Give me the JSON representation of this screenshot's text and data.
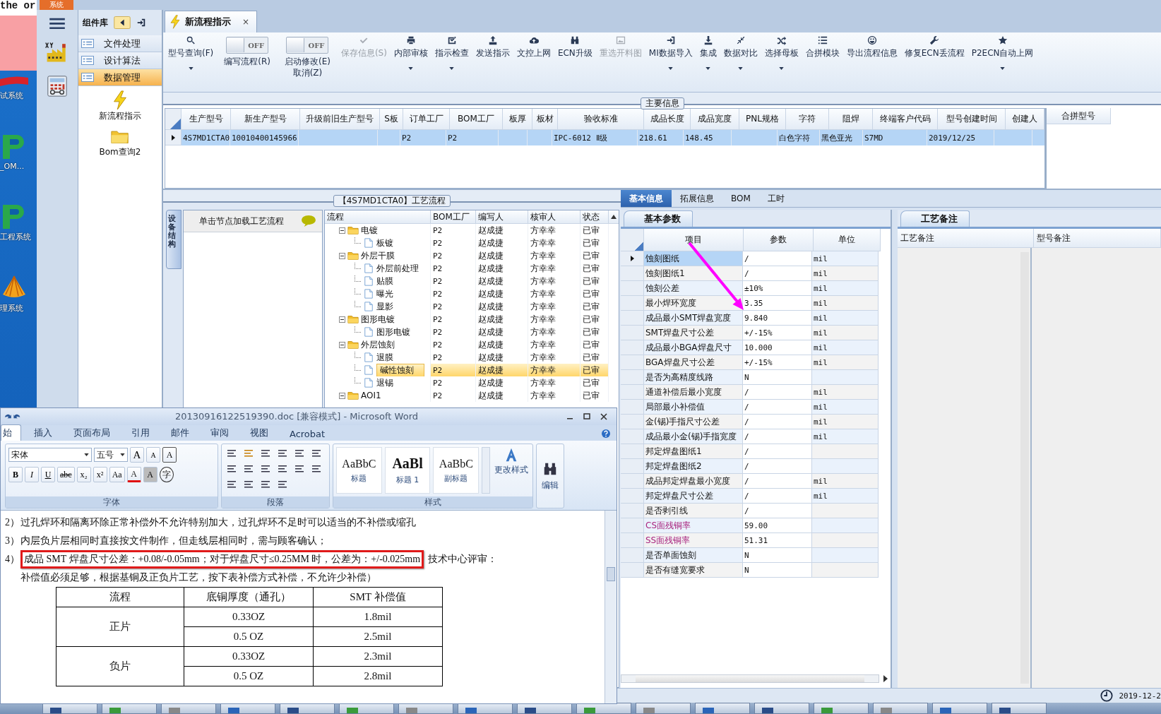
{
  "desktop": {
    "corner_text": "the or",
    "icons": [
      {
        "label": "试系统"
      },
      {
        "label": "_OM..."
      },
      {
        "label": "工程系统"
      },
      {
        "label": "理系统"
      }
    ]
  },
  "app": {
    "menu_tab": "系统",
    "component_library": {
      "title": "组件库",
      "items": [
        {
          "label": "文件处理",
          "selected": false
        },
        {
          "label": "设计算法",
          "selected": false
        },
        {
          "label": "数据管理",
          "selected": true
        }
      ],
      "tools": [
        {
          "label": "新流程指示",
          "kind": "bolt"
        },
        {
          "label": "Bom查询2",
          "kind": "folder"
        }
      ]
    },
    "doc_tab": {
      "label": "新流程指示",
      "close": "×"
    },
    "toolbar": [
      {
        "kind": "button",
        "label": "型号查询(F)",
        "dropdown": true,
        "disabled": false
      },
      {
        "kind": "toggle",
        "switch_text": "OFF",
        "on": false,
        "label": "编写流程(R)"
      },
      {
        "kind": "toggle",
        "switch_text": "OFF",
        "on": false,
        "label": "启动修改(E)",
        "label_line2": "取消(Z)"
      },
      {
        "kind": "button",
        "label": "保存信息(S)",
        "dropdown": false,
        "disabled": true
      },
      {
        "kind": "button",
        "label": "内部审核",
        "dropdown": true,
        "disabled": false
      },
      {
        "kind": "button",
        "label": "指示检查",
        "dropdown": true,
        "disabled": false
      },
      {
        "kind": "button",
        "label": "发送指示",
        "dropdown": false,
        "disabled": false
      },
      {
        "kind": "button",
        "label": "文控上网",
        "dropdown": false,
        "disabled": false
      },
      {
        "kind": "button",
        "label": "ECN升级",
        "dropdown": false,
        "disabled": false
      },
      {
        "kind": "button",
        "label": "重选开料图",
        "dropdown": false,
        "disabled": true
      },
      {
        "kind": "button",
        "label": "MI数据导入",
        "dropdown": true,
        "disabled": false
      },
      {
        "kind": "button",
        "label": "集成",
        "dropdown": true,
        "disabled": false
      },
      {
        "kind": "button",
        "label": "数据对比",
        "dropdown": true,
        "disabled": false
      },
      {
        "kind": "button",
        "label": "选择母板",
        "dropdown": true,
        "disabled": false
      },
      {
        "kind": "button",
        "label": "合拼模块",
        "dropdown": false,
        "disabled": false
      },
      {
        "kind": "button",
        "label": "导出流程信息",
        "dropdown": false,
        "disabled": false
      },
      {
        "kind": "button",
        "label": "修复ECN丢流程",
        "dropdown": false,
        "disabled": false
      },
      {
        "kind": "button",
        "label": "P2ECN自动上网",
        "dropdown": true,
        "disabled": false
      }
    ],
    "main_info": {
      "title": "主要信息",
      "columns": [
        "生产型号",
        "新生产型号",
        "升级前旧生产型号",
        "S板",
        "订单工厂",
        "BOM工厂",
        "板厚",
        "板材",
        "验收标准",
        "成品长度",
        "成品宽度",
        "PNL规格",
        "字符",
        "阻焊",
        "终端客户代码",
        "型号创建时间",
        "创建人"
      ],
      "rows": [
        {
          "selected": true,
          "cells": [
            "4S7MD1CTA0",
            "10010400145966",
            null,
            null,
            "P2",
            "P2",
            null,
            null,
            "IPC-6012 Ⅱ级",
            "218.61",
            "148.45",
            null,
            "白色字符",
            "黑色亚光",
            "S7MD",
            "2019/12/25",
            null
          ]
        }
      ],
      "side_column": "合拼型号"
    },
    "flow": {
      "title": "【4S7MD1CTA0】工艺流程",
      "side_tab": "设备结构",
      "hint": "单击节点加载工艺流程",
      "columns": [
        "流程",
        "BOM工厂",
        "编写人",
        "核审人",
        "状态"
      ],
      "tree": [
        {
          "kind": "folder",
          "label": "电镀",
          "factory": "P2",
          "writer": "赵成捷",
          "reviewer": "方幸幸",
          "status": "已审",
          "expanded": true,
          "selected": false,
          "children": [
            {
              "kind": "step",
              "label": "板镀",
              "factory": "P2",
              "writer": "赵成捷",
              "reviewer": "方幸幸",
              "status": "已审",
              "selected": false
            }
          ]
        },
        {
          "kind": "folder",
          "label": "外层干膜",
          "factory": "P2",
          "writer": "赵成捷",
          "reviewer": "方幸幸",
          "status": "已审",
          "expanded": true,
          "selected": false,
          "children": [
            {
              "kind": "step",
              "label": "外层前处理",
              "factory": "P2",
              "writer": "赵成捷",
              "reviewer": "方幸幸",
              "status": "已审",
              "selected": false
            },
            {
              "kind": "step",
              "label": "贴膜",
              "factory": "P2",
              "writer": "赵成捷",
              "reviewer": "方幸幸",
              "status": "已审",
              "selected": false
            },
            {
              "kind": "step",
              "label": "曝光",
              "factory": "P2",
              "writer": "赵成捷",
              "reviewer": "方幸幸",
              "status": "已审",
              "selected": false
            },
            {
              "kind": "step",
              "label": "显影",
              "factory": "P2",
              "writer": "赵成捷",
              "reviewer": "方幸幸",
              "status": "已审",
              "selected": false
            }
          ]
        },
        {
          "kind": "folder",
          "label": "图形电镀",
          "factory": "P2",
          "writer": "赵成捷",
          "reviewer": "方幸幸",
          "status": "已审",
          "expanded": true,
          "selected": false,
          "children": [
            {
              "kind": "step",
              "label": "图形电镀",
              "factory": "P2",
              "writer": "赵成捷",
              "reviewer": "方幸幸",
              "status": "已审",
              "selected": false
            }
          ]
        },
        {
          "kind": "folder",
          "label": "外层蚀刻",
          "factory": "P2",
          "writer": "赵成捷",
          "reviewer": "方幸幸",
          "status": "已审",
          "expanded": true,
          "selected": false,
          "children": [
            {
              "kind": "step",
              "label": "退膜",
              "factory": "P2",
              "writer": "赵成捷",
              "reviewer": "方幸幸",
              "status": "已审",
              "selected": false
            },
            {
              "kind": "step",
              "label": "碱性蚀刻",
              "factory": "P2",
              "writer": "赵成捷",
              "reviewer": "方幸幸",
              "status": "已审",
              "selected": true
            },
            {
              "kind": "step",
              "label": "退锡",
              "factory": "P2",
              "writer": "赵成捷",
              "reviewer": "方幸幸",
              "status": "已审",
              "selected": false
            }
          ]
        },
        {
          "kind": "folder",
          "label": "AOI1",
          "factory": "P2",
          "writer": "赵成捷",
          "reviewer": "方幸幸",
          "status": "已审",
          "expanded": true,
          "selected": false
        }
      ]
    },
    "detail": {
      "tabs": [
        {
          "label": "基本信息",
          "selected": true
        },
        {
          "label": "拓展信息",
          "selected": false
        },
        {
          "label": "BOM",
          "selected": false
        },
        {
          "label": "工时",
          "selected": false
        }
      ],
      "params": {
        "title": "基本参数",
        "columns": [
          "项目",
          "参数",
          "单位"
        ],
        "rows": [
          {
            "item": "蚀刻图纸",
            "value": "/",
            "unit": "mil",
            "selected": true,
            "highlighted": false
          },
          {
            "item": "蚀刻图纸1",
            "value": "/",
            "unit": "mil",
            "selected": false,
            "highlighted": false
          },
          {
            "item": "蚀刻公差",
            "value": "±10%",
            "unit": "mil",
            "selected": false,
            "highlighted": false
          },
          {
            "item": "最小焊环宽度",
            "value": "3.35",
            "unit": "mil",
            "selected": false,
            "highlighted": false
          },
          {
            "item": "成品最小SMT焊盘宽度",
            "value": "9.840",
            "unit": "mil",
            "selected": false,
            "highlighted": false
          },
          {
            "item": "SMT焊盘尺寸公差",
            "value": "+/-15%",
            "unit": "mil",
            "selected": false,
            "highlighted": false
          },
          {
            "item": "成品最小BGA焊盘尺寸",
            "value": "10.000",
            "unit": "mil",
            "selected": false,
            "highlighted": false
          },
          {
            "item": "BGA焊盘尺寸公差",
            "value": "+/-15%",
            "unit": "mil",
            "selected": false,
            "highlighted": false
          },
          {
            "item": "是否为高精度线路",
            "value": "N",
            "selected": false,
            "highlighted": false
          },
          {
            "item": "通道补偿后最小宽度",
            "value": "/",
            "unit": "mil",
            "selected": false,
            "highlighted": false
          },
          {
            "item": "局部最小补偿值",
            "value": "/",
            "unit": "mil",
            "selected": false,
            "highlighted": false
          },
          {
            "item": "金(锡)手指尺寸公差",
            "value": "/",
            "unit": "mil",
            "selected": false,
            "highlighted": false
          },
          {
            "item": "成品最小金(锡)手指宽度",
            "value": "/",
            "unit": "mil",
            "selected": false,
            "highlighted": false
          },
          {
            "item": "邦定焊盘图纸1",
            "value": "/",
            "selected": false,
            "highlighted": false
          },
          {
            "item": "邦定焊盘图纸2",
            "value": "/",
            "selected": false,
            "highlighted": false
          },
          {
            "item": "成品邦定焊盘最小宽度",
            "value": "/",
            "unit": "mil",
            "selected": false,
            "highlighted": false
          },
          {
            "item": "邦定焊盘尺寸公差",
            "value": "/",
            "unit": "mil",
            "selected": false,
            "highlighted": false
          },
          {
            "item": "是否剥引线",
            "value": "/",
            "selected": false,
            "highlighted": false
          },
          {
            "item": "CS面残铜率",
            "value": "59.00",
            "selected": false,
            "highlighted": true
          },
          {
            "item": "SS面残铜率",
            "value": "51.31",
            "selected": false,
            "highlighted": true
          },
          {
            "item": "是否单面蚀刻",
            "value": "N",
            "selected": false,
            "highlighted": false
          },
          {
            "item": "是否有缝宽要求",
            "value": "N",
            "selected": false,
            "highlighted": false
          }
        ]
      },
      "notes": {
        "title": "工艺备注",
        "columns": [
          "工艺备注",
          "型号备注"
        ]
      }
    },
    "status_bar": {
      "date": "2019-12-2"
    }
  },
  "word": {
    "title": "20130916122519390.doc [兼容模式] - Microsoft Word",
    "tabs": [
      {
        "label": "始",
        "selected": true
      },
      {
        "label": "插入",
        "selected": false
      },
      {
        "label": "页面布局",
        "selected": false
      },
      {
        "label": "引用",
        "selected": false
      },
      {
        "label": "邮件",
        "selected": false
      },
      {
        "label": "审阅",
        "selected": false
      },
      {
        "label": "视图",
        "selected": false
      },
      {
        "label": "Acrobat",
        "selected": false
      }
    ],
    "font": {
      "name": "宋体",
      "size": "五号",
      "row1": [
        {
          "text": "A",
          "kind": "grow"
        },
        {
          "text": "A",
          "kind": "shrink"
        },
        {
          "text": "A",
          "kind": "boxed"
        }
      ],
      "row2": [
        {
          "text": "B",
          "kind": "bold"
        },
        {
          "text": "I",
          "kind": "italic"
        },
        {
          "text": "U",
          "kind": "underline"
        },
        {
          "text": "abc",
          "kind": "strike"
        },
        {
          "text": "x₂",
          "kind": "plain"
        },
        {
          "text": "x²",
          "kind": "plain"
        },
        {
          "text": "Aa",
          "kind": "plain"
        },
        {
          "text": "A",
          "kind": "red"
        },
        {
          "text": "A",
          "kind": "shaded"
        },
        {
          "text": "字",
          "kind": "circled"
        }
      ],
      "group": "字体"
    },
    "paragraph_group": "段落",
    "styles": {
      "items": [
        {
          "preview": "AaBbC",
          "label": "标题"
        },
        {
          "preview": "AaBl",
          "label": "标题 1"
        },
        {
          "preview": "AaBbC",
          "label": "副标题"
        }
      ],
      "change": "更改样式",
      "group": "样式"
    },
    "edit": "编辑",
    "body": {
      "lines": [
        {
          "num": "2）",
          "text": "过孔焊环和隔离环除正常补偿外不允许特别加大，过孔焊环不足时可以适当的不补偿或缩孔"
        },
        {
          "num": "3）",
          "text": "内层负片层相同时直接按文件制作，但走线层相同时，需与顾客确认；"
        }
      ],
      "item4": {
        "num": "4）",
        "highlighted": "成品 SMT 焊盘尺寸公差：+0.08/-0.05mm；对于焊盘尺寸≤0.25MM 时，公差为：+/-0.025mm",
        "rest": "技术中心评审：",
        "continued": "补偿值必须足够，根据基铜及正负片工艺，按下表补偿方式补偿，不允许少补偿）"
      },
      "table": {
        "columns": [
          "流程",
          "底铜厚度（通孔）",
          "SMT 补偿值"
        ],
        "groups": [
          {
            "name": "正片",
            "rows": [
              [
                "0.33OZ",
                "1.8mil"
              ],
              [
                "0.5 OZ",
                "2.5mil"
              ]
            ]
          },
          {
            "name": "负片",
            "rows": [
              [
                "0.33OZ",
                "2.3mil"
              ],
              [
                "0.5 OZ",
                "2.8mil"
              ]
            ]
          }
        ]
      }
    }
  }
}
